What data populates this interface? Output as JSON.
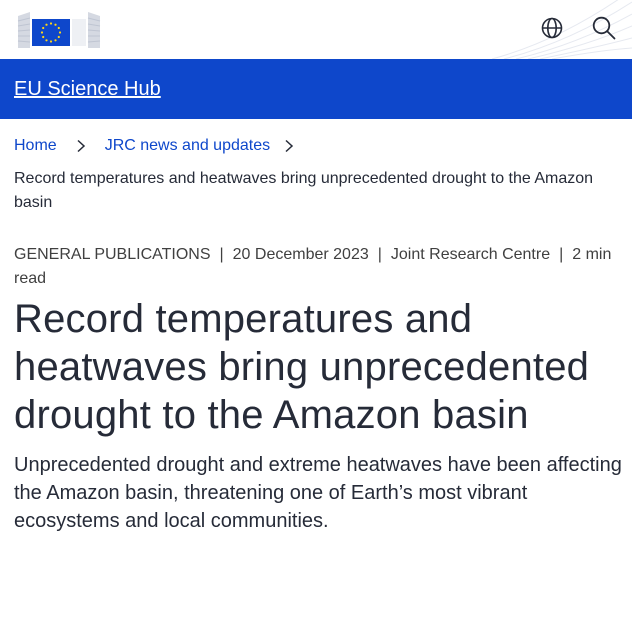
{
  "header": {
    "logo_icon": "european-commission-logo",
    "globe_icon": "globe-icon",
    "search_icon": "search-icon"
  },
  "site": {
    "name": "EU Science Hub",
    "brand_color": "#0e47cb"
  },
  "breadcrumb": {
    "items": [
      "Home",
      "JRC news and updates"
    ],
    "current": "Record temperatures and heatwaves bring unprecedented drought to the Amazon basin"
  },
  "meta": {
    "type": "GENERAL PUBLICATIONS",
    "date": "20 December 2023",
    "author": "Joint Research Centre",
    "reading_time": "2 min read"
  },
  "article": {
    "title": "Record temperatures and heatwaves bring unprecedented drought to the Amazon basin",
    "lead": "Unprecedented drought and extreme heatwaves have been affecting the Amazon basin, threatening one of Earth’s most vibrant ecosystems and local communities."
  }
}
